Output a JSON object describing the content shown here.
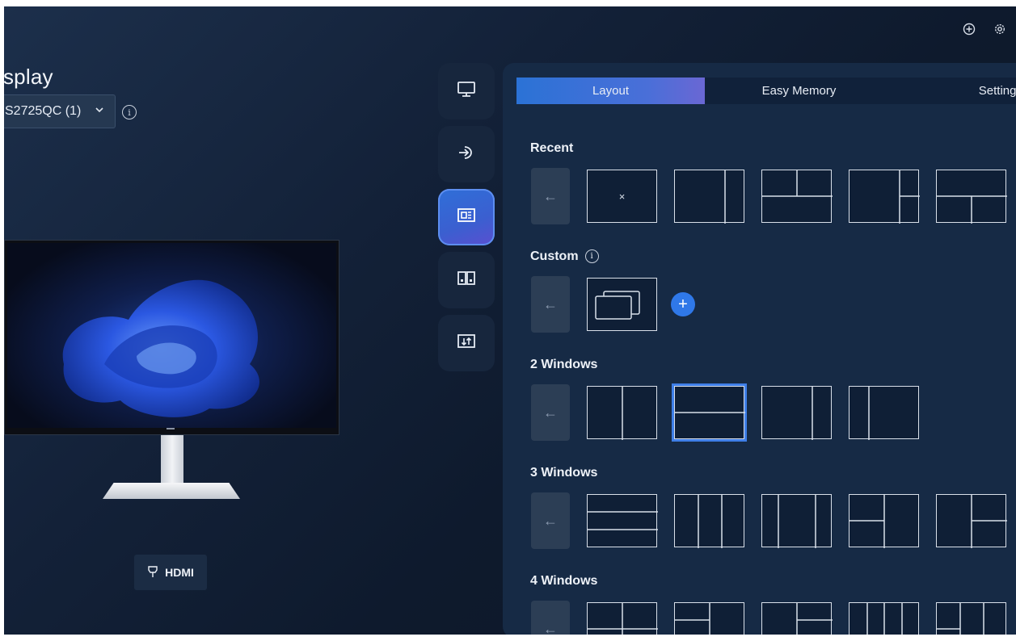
{
  "left": {
    "title": "isplay",
    "monitor_select": "S2725QC (1)",
    "input_label": "HDMI"
  },
  "tabs": [
    "Layout",
    "Easy Memory",
    "Settings"
  ],
  "sections": {
    "recent": "Recent",
    "custom": "Custom",
    "two": "2 Windows",
    "three": "3 Windows",
    "four": "4 Windows"
  },
  "glyphs": {
    "back_arrow": "←",
    "remove": "×",
    "add": "+",
    "chevron": "⌄",
    "info": "i"
  },
  "icons": [
    "add-circle-icon",
    "gear-icon",
    "monitor-icon",
    "input-source-icon",
    "layout-icon",
    "pip-icon",
    "menu-settings-icon"
  ],
  "colors": {
    "accent": "#2f78e8",
    "selected_outline": "#3f7fe8",
    "panel_bg": "#162a45"
  }
}
